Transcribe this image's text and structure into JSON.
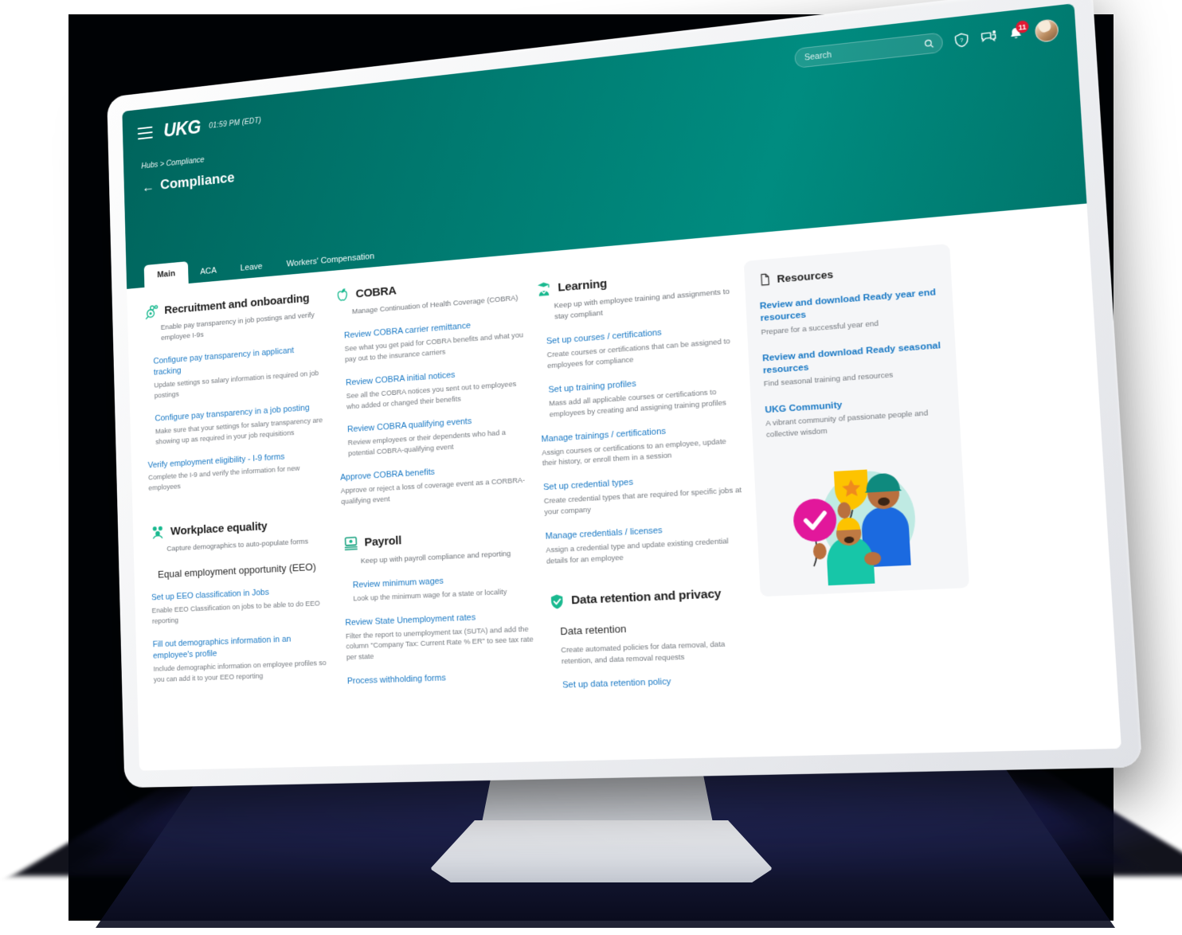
{
  "header": {
    "logo": "UKG",
    "clock": "01:59 PM (EDT)",
    "breadcrumb": "Hubs > Compliance",
    "page_title": "Compliance",
    "back_arrow": "←",
    "search_placeholder": "Search",
    "search_value": "",
    "notification_count": "11",
    "accent_teal": "#007a70",
    "link_blue": "#1878c4"
  },
  "tabs": [
    {
      "label": "Main",
      "active": true
    },
    {
      "label": "ACA",
      "active": false
    },
    {
      "label": "Leave",
      "active": false
    },
    {
      "label": "Workers' Compensation",
      "active": false
    }
  ],
  "sections": {
    "recruitment": {
      "title": "Recruitment and onboarding",
      "description": "Enable pay transparency in job postings and verify employee I-9s",
      "links": [
        {
          "title": "Configure pay transparency in applicant tracking",
          "desc": "Update settings so salary information is required on job postings"
        },
        {
          "title": "Configure pay transparency in a job posting",
          "desc": "Make sure that your settings for salary transparency are showing up as required in your job requisitions"
        },
        {
          "title": "Verify employment eligibility - I-9 forms",
          "desc": "Complete the I-9 and verify the information for new employees"
        }
      ]
    },
    "workplace_equality": {
      "title": "Workplace equality",
      "description": "Capture demographics to auto-populate forms",
      "subheading": "Equal employment opportunity (EEO)",
      "links": [
        {
          "title": "Set up EEO classification in Jobs",
          "desc": "Enable EEO Classification on jobs to be able to do EEO reporting"
        },
        {
          "title": "Fill out demographics information in an employee's profile",
          "desc": "Include demographic information on employee profiles so you can add it to your EEO reporting"
        }
      ]
    },
    "cobra": {
      "title": "COBRA",
      "description": "Manage Continuation of Health Coverage (COBRA)",
      "links": [
        {
          "title": "Review COBRA carrier remittance",
          "desc": "See what you get paid for COBRA benefits and what you pay out to the insurance carriers"
        },
        {
          "title": "Review COBRA initial notices",
          "desc": "See all the COBRA notices you sent out to employees who added or changed their benefits"
        },
        {
          "title": "Review COBRA qualifying events",
          "desc": "Review employees or their dependents who had a potential COBRA-qualifying event"
        },
        {
          "title": "Approve COBRA benefits",
          "desc": "Approve or reject a loss of coverage event as a CORBRA-qualifying event"
        }
      ]
    },
    "payroll": {
      "title": "Payroll",
      "description": "Keep up with payroll compliance and reporting",
      "links": [
        {
          "title": "Review minimum wages",
          "desc": "Look up the minimum wage for a state or locality"
        },
        {
          "title": "Review State Unemployment rates",
          "desc": "Filter the report to unemployment tax (SUTA) and add the column \"Company Tax: Current Rate % ER\" to see tax rate per state"
        },
        {
          "title": "Process withholding forms",
          "desc": ""
        }
      ]
    },
    "learning": {
      "title": "Learning",
      "description": "Keep up with employee training and assignments to stay compliant",
      "links": [
        {
          "title": "Set up courses / certifications",
          "desc": "Create courses or certifications that can be assigned to employees for compliance"
        },
        {
          "title": "Set up training profiles",
          "desc": "Mass add all applicable courses or certifications to employees by creating and assigning training profiles"
        },
        {
          "title": "Manage trainings / certifications",
          "desc": "Assign courses or certifications to an employee, update their history, or enroll them in a session"
        },
        {
          "title": "Set up credential types",
          "desc": "Create credential types that are required for specific jobs at your company"
        },
        {
          "title": "Manage credentials / licenses",
          "desc": "Assign a credential type and update existing credential details for an employee"
        }
      ]
    },
    "data_retention": {
      "title": "Data retention and privacy",
      "subheading": "Data retention",
      "description": "Create automated policies for data removal, data retention, and data removal requests",
      "links": [
        {
          "title": "Set up data retention policy",
          "desc": ""
        }
      ]
    }
  },
  "resources": {
    "title": "Resources",
    "items": [
      {
        "title": "Review and download Ready year end resources",
        "desc": "Prepare for a successful year end"
      },
      {
        "title": "Review and download Ready seasonal resources",
        "desc": "Find seasonal training and resources"
      },
      {
        "title": "UKG Community",
        "desc": "A vibrant community of passionate people and collective wisdom"
      }
    ]
  }
}
